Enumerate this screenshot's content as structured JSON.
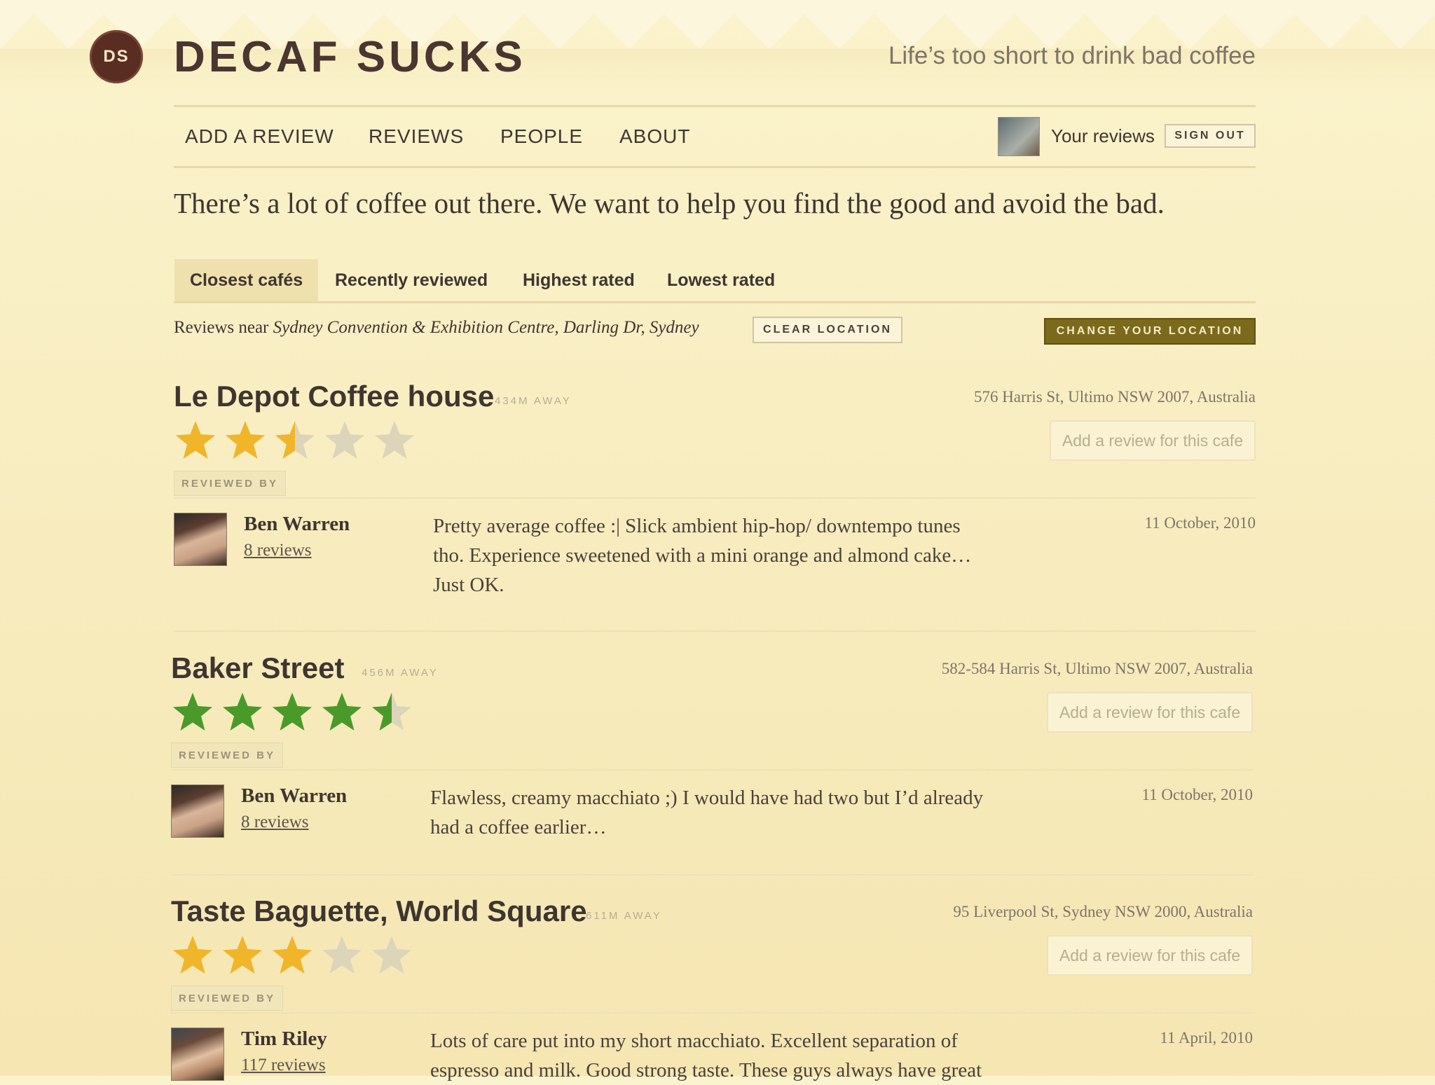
{
  "site": {
    "logo_initials": "DS",
    "title": "DECAF SUCKS",
    "tagline": "Life’s too short to drink bad coffee"
  },
  "nav": {
    "items": [
      "ADD A REVIEW",
      "REVIEWS",
      "PEOPLE",
      "ABOUT"
    ],
    "your_reviews": "Your reviews",
    "sign_out": "SIGN OUT"
  },
  "intro": "There’s a lot of coffee out there. We want to help you find the good and avoid the bad.",
  "tabs": [
    "Closest cafés",
    "Recently reviewed",
    "Highest rated",
    "Lowest rated"
  ],
  "active_tab": "Closest cafés",
  "location": {
    "prefix": "Reviews near",
    "place": "Sydney Convention & Exhibition Centre, Darling Dr, Sydney",
    "clear_label": "CLEAR LOCATION",
    "change_label": "CHANGE YOUR LOCATION"
  },
  "colors": {
    "star_gold": "#f1b52a",
    "star_green": "#4a9a2a",
    "star_empty": "#ddd5ba",
    "accent": "#7c6a1c"
  },
  "cafes": [
    {
      "name": "Le Depot Coffee house",
      "distance": "434M AWAY",
      "address": "576 Harris St, Ultimo NSW 2007, Australia",
      "add_review": "Add a review for this cafe",
      "rating": 2.5,
      "star_color": "gold",
      "reviewed_by_label": "REVIEWED BY",
      "review": {
        "reviewer": "Ben Warren",
        "reviewer_count": "8 reviews",
        "text": "Pretty average coffee :| Slick ambient hip-hop/ downtempo tunes tho. Experience sweetened with a mini orange and almond cake… Just OK.",
        "date": "11 October, 2010"
      }
    },
    {
      "name": "Baker Street",
      "distance": "456M AWAY",
      "address": "582-584 Harris St, Ultimo NSW 2007, Australia",
      "add_review": "Add a review for this cafe",
      "rating": 4.5,
      "star_color": "green",
      "reviewed_by_label": "REVIEWED BY",
      "review": {
        "reviewer": "Ben Warren",
        "reviewer_count": "8 reviews",
        "text": "Flawless, creamy macchiato ;) I would have had two but I’d already had a coffee earlier…",
        "date": "11 October, 2010"
      }
    },
    {
      "name": "Taste Baguette, World Square",
      "distance": "611M AWAY",
      "address": "95 Liverpool St, Sydney NSW 2000, Australia",
      "add_review": "Add a review for this cafe",
      "rating": 3,
      "star_color": "gold",
      "reviewed_by_label": "REVIEWED BY",
      "review": {
        "reviewer": "Tim Riley",
        "reviewer_count": "117 reviews",
        "text": "Lots of care put into my short macchiato. Excellent separation of espresso and milk. Good strong taste. These guys always have great",
        "date": "11 April, 2010"
      }
    }
  ]
}
